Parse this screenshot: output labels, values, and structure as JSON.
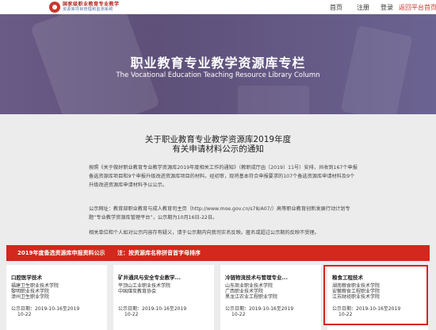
{
  "header": {
    "logo_line1": "国家级职业教育专业教学",
    "logo_line2": "资源库项目管理和监测系统",
    "nav": [
      "首页",
      "注册",
      "登录"
    ],
    "return_link": "返回平台首页"
  },
  "banner": {
    "title": "职业教育专业教学资源库专栏",
    "subtitle": "The Vocational Education Teaching Resource Library Column"
  },
  "notice": {
    "title_line1": "关于职业教育专业教学资源库2019年度",
    "title_line2": "有关申请材料公示的通知",
    "paragraph1": "按照《关于做好职业教育专业教学资源库2019年度相关工作的通知》（教职成厅函〔2019〕11号）安排，共收到167个申报备选资源库项目和9个申报升级改进资源库项目的材料。经初审，现将基本符合申报要求的107个备选资源库申请材料及9个升级改进资源库申请材料予以公示。",
    "paragraph2": "公示网址：教育部职业教育与成人教育司主页（http://www.moe.gov.cn/s78/A07/）高等职业教育创新发展行动计划专题“专业教学资源库管理平台”，公示期为10月16日-22日。",
    "paragraph3": "相关单位和个人如对公示内容存有疑义，请于公示期内向我司实名反映。匿名或超过公示期的反映不受理。"
  },
  "redbar": {
    "left": "2019年度备选资源库申报资料公示",
    "right": "注：按资源库名称拼音首字母排序"
  },
  "cards": [
    {
      "title": "口腔医学技术",
      "schools": [
        "福建卫生职业技术学院",
        "黎明职业技术学院",
        "漳州卫生职业学院"
      ],
      "date": "公示日期：2019-10-16至2019",
      "date_tail": "10-22"
    },
    {
      "title": "矿井通风与安全专业教学...",
      "schools": [
        "平顶山工业职业技术学院",
        "中国煤炭教育协会"
      ],
      "date": "公示日期：2019-10-16至2019",
      "date_tail": "10-22"
    },
    {
      "title": "冷链物流技术与管理专业...",
      "schools": [
        "山东商业职业技术学院",
        "广西职业技术学院",
        "黑龙江农业工程职业学院"
      ],
      "date": "公示日期：2019-10-16至2019",
      "date_tail": "10-22"
    },
    {
      "title": "粮食工程技术",
      "schools": [
        "湖南粮食职业技术学院",
        "安徽粮食工程职业学院",
        "江苏财经职业技术学院"
      ],
      "date": "公示日期：2019-10-16至2019",
      "date_tail": "10-22"
    }
  ]
}
